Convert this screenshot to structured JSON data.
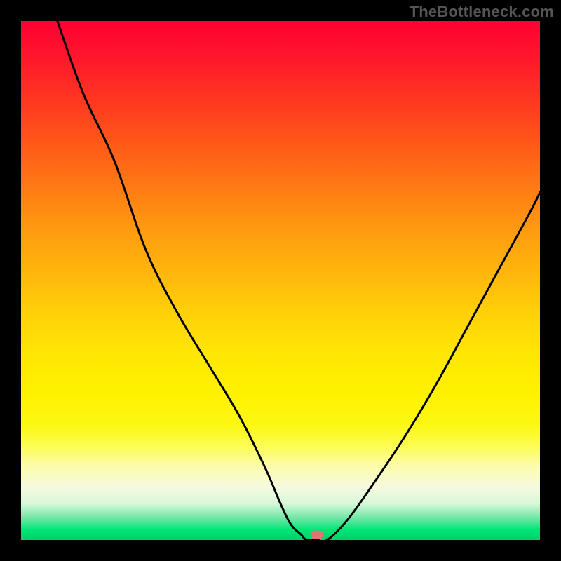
{
  "watermark": "TheBottleneck.com",
  "chart_data": {
    "type": "line",
    "title": "",
    "xlabel": "",
    "ylabel": "",
    "xlim": [
      0,
      100
    ],
    "ylim": [
      0,
      100
    ],
    "gradient_bands": [
      {
        "y": 100,
        "color": "#ff0033"
      },
      {
        "y": 92,
        "color": "#ff1a2b"
      },
      {
        "y": 84,
        "color": "#ff3a1f"
      },
      {
        "y": 76,
        "color": "#ff5a18"
      },
      {
        "y": 68,
        "color": "#ff7a14"
      },
      {
        "y": 60,
        "color": "#ff9a10"
      },
      {
        "y": 52,
        "color": "#ffb40c"
      },
      {
        "y": 44,
        "color": "#ffd008"
      },
      {
        "y": 36,
        "color": "#ffe604"
      },
      {
        "y": 28,
        "color": "#fff200"
      },
      {
        "y": 22,
        "color": "#fcf814"
      },
      {
        "y": 18,
        "color": "#fdfd55"
      },
      {
        "y": 14,
        "color": "#fcfcb0"
      },
      {
        "y": 10,
        "color": "#f5fae0"
      },
      {
        "y": 7,
        "color": "#d8f8d8"
      },
      {
        "y": 4,
        "color": "#66e6a0"
      },
      {
        "y": 2,
        "color": "#00e676"
      },
      {
        "y": 0,
        "color": "#00d06a"
      }
    ],
    "series": [
      {
        "name": "left-branch",
        "x": [
          7,
          12,
          18,
          24,
          30,
          36,
          42,
          47,
          50,
          52,
          54,
          55
        ],
        "y": [
          100,
          86,
          73,
          56,
          44,
          34,
          24,
          14,
          7,
          3,
          1,
          0
        ]
      },
      {
        "name": "valley-floor",
        "x": [
          55,
          57,
          59
        ],
        "y": [
          0,
          0,
          0
        ]
      },
      {
        "name": "right-branch",
        "x": [
          59,
          63,
          68,
          74,
          80,
          86,
          92,
          98,
          100
        ],
        "y": [
          0,
          4,
          11,
          20,
          30,
          41,
          52,
          63,
          67
        ]
      }
    ],
    "marker": {
      "x": 57,
      "y": 1,
      "color": "#e57373"
    }
  }
}
